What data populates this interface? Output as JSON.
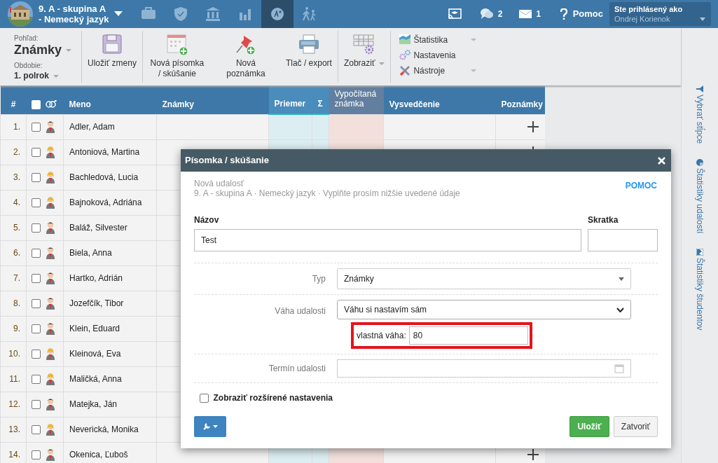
{
  "top_bar": {
    "class_title": [
      "9. A - skupina A",
      "- Nemecký jazyk"
    ],
    "nav_icons": [
      {
        "kind": "briefcase",
        "selected": false
      },
      {
        "kind": "shield",
        "selected": false
      },
      {
        "kind": "bank",
        "selected": false
      },
      {
        "kind": "chart",
        "selected": false
      },
      {
        "kind": "grade",
        "selected": true
      },
      {
        "kind": "walk",
        "selected": false
      }
    ],
    "messages_count": "2",
    "mail_count": "1",
    "help": "Pomoc",
    "user": {
      "label": "Ste prihlásený ako",
      "name": "Ondrej Korienok"
    }
  },
  "toolbar": {
    "view": {
      "label": "Pohľad:",
      "value": "Známky"
    },
    "period": {
      "label": "Obdobie:",
      "value": "1. polrok"
    },
    "buttons": [
      {
        "kind": "save",
        "label": "Uložiť zmeny"
      },
      {
        "kind": "exam",
        "label": "Nová písomka / skúšanie"
      },
      {
        "kind": "note",
        "label": "Nová poznámka"
      },
      {
        "kind": "print",
        "label": "Tlač / export"
      },
      {
        "kind": "display",
        "label": "Zobraziť"
      }
    ],
    "menu": [
      {
        "kind": "stats",
        "label": "Štatistika",
        "dropdown": true
      },
      {
        "kind": "settings",
        "label": "Nastavenia",
        "dropdown": false
      },
      {
        "kind": "tools",
        "label": "Nástroje",
        "dropdown": true
      }
    ]
  },
  "table": {
    "columns": [
      "#",
      "Meno",
      "Známky",
      "Priemer",
      "Σ",
      "Vypočítaná známka",
      "Vysvedčenie",
      "Poznámky"
    ],
    "select_all_checked": false,
    "rows": [
      {
        "number": "1.",
        "name": "Adler, Adam",
        "kind": "male",
        "checked": false,
        "add_note": true
      },
      {
        "number": "2.",
        "name": "Antoniová, Martina",
        "kind": "female",
        "checked": false,
        "add_note": true
      },
      {
        "number": "3.",
        "name": "Bachledová, Lucia",
        "kind": "female",
        "checked": false,
        "add_note": false
      },
      {
        "number": "4.",
        "name": "Bajnoková, Adriána",
        "kind": "female",
        "checked": false,
        "add_note": false
      },
      {
        "number": "5.",
        "name": "Baláž, Silvester",
        "kind": "male",
        "checked": false,
        "add_note": false
      },
      {
        "number": "6.",
        "name": "Biela, Anna",
        "kind": "male",
        "checked": false,
        "add_note": false
      },
      {
        "number": "7.",
        "name": "Hartko, Adrián",
        "kind": "male",
        "checked": false,
        "add_note": false
      },
      {
        "number": "8.",
        "name": "Jozefčík, Tibor",
        "kind": "male",
        "checked": false,
        "add_note": false
      },
      {
        "number": "9.",
        "name": "Klein, Eduard",
        "kind": "male",
        "checked": false,
        "add_note": false
      },
      {
        "number": "10.",
        "name": "Kleinová, Eva",
        "kind": "female",
        "checked": false,
        "add_note": false
      },
      {
        "number": "11.",
        "name": "Maličká, Anna",
        "kind": "female",
        "checked": false,
        "add_note": false
      },
      {
        "number": "12.",
        "name": "Matejka, Ján",
        "kind": "male",
        "checked": false,
        "add_note": false
      },
      {
        "number": "13.",
        "name": "Neverická, Monika",
        "kind": "female",
        "checked": false,
        "add_note": false
      },
      {
        "number": "14.",
        "name": "Okenica, Ľuboš",
        "kind": "male",
        "checked": false,
        "add_note": true
      }
    ]
  },
  "sidebar": {
    "items": [
      {
        "kind": "filter",
        "label": "Vybrať stĺpce"
      },
      {
        "kind": "pie",
        "label": "Štatistiky udalostí"
      },
      {
        "kind": "bars",
        "label": "Štatistiky študentov"
      }
    ]
  },
  "modal": {
    "title": "Písomka / skúšanie",
    "subtitle": "Nová udalosť",
    "context": "9. A - skupina A · Nemecký jazyk · Vyplňte prosím nižšie uvedené údaje",
    "help": "POMOC",
    "name": {
      "label": "Názov",
      "value": "Test"
    },
    "short": {
      "label": "Skratka"
    },
    "type": {
      "label": "Typ",
      "value": "Známky"
    },
    "weight": {
      "label": "Váha udalosti",
      "value": "Váhu si nastavím sám",
      "custom_label": "vlastná váha:",
      "custom_value": "80",
      "highlighted": true
    },
    "date": {
      "label": "Termín udalosti"
    },
    "advanced": {
      "label": "Zobraziť rozšírené nastavenia",
      "checked": false
    },
    "buttons": [
      {
        "kind": "tools"
      },
      {
        "kind": "primary",
        "label": "Uložiť"
      },
      {
        "kind": "secondary",
        "label": "Zatvoriť"
      }
    ]
  }
}
